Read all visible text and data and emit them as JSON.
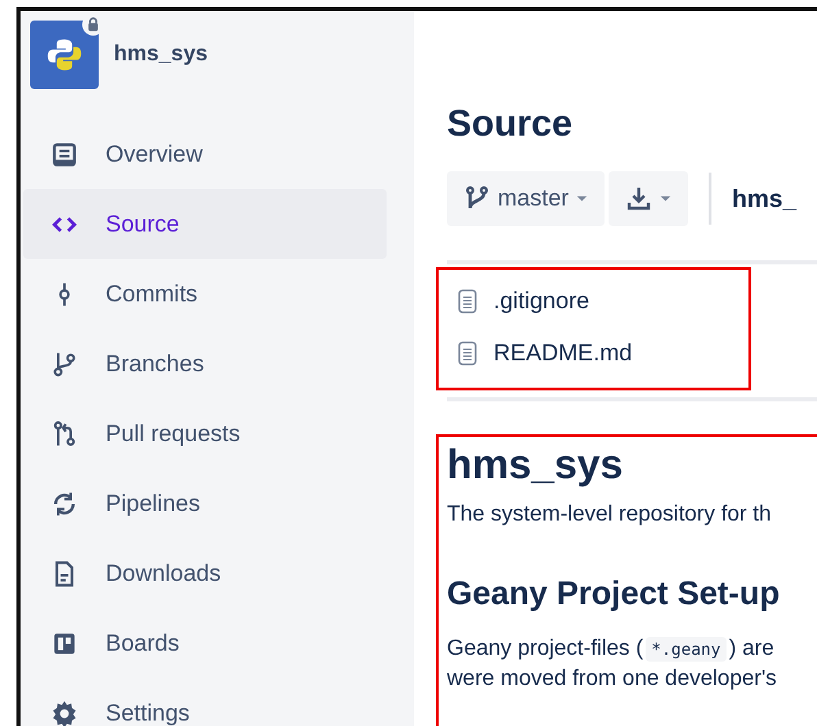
{
  "repository": {
    "name": "hms_sys",
    "private": true
  },
  "sidebar": {
    "items": [
      {
        "label": "Overview",
        "selected": false
      },
      {
        "label": "Source",
        "selected": true
      },
      {
        "label": "Commits",
        "selected": false
      },
      {
        "label": "Branches",
        "selected": false
      },
      {
        "label": "Pull requests",
        "selected": false
      },
      {
        "label": "Pipelines",
        "selected": false
      },
      {
        "label": "Downloads",
        "selected": false
      },
      {
        "label": "Boards",
        "selected": false
      },
      {
        "label": "Settings",
        "selected": false
      }
    ]
  },
  "page_title": "Source",
  "toolbar": {
    "branch": "master",
    "path": "hms_"
  },
  "files": [
    {
      "name": ".gitignore"
    },
    {
      "name": "README.md"
    }
  ],
  "readme": {
    "title": "hms_sys",
    "intro": "The system-level repository for th",
    "section_title": "Geany Project Set-up",
    "paragraph": {
      "before": "Geany project-files (",
      "code": "*.geany",
      "after": ") are",
      "line_2": "were moved from one developer's"
    }
  }
}
